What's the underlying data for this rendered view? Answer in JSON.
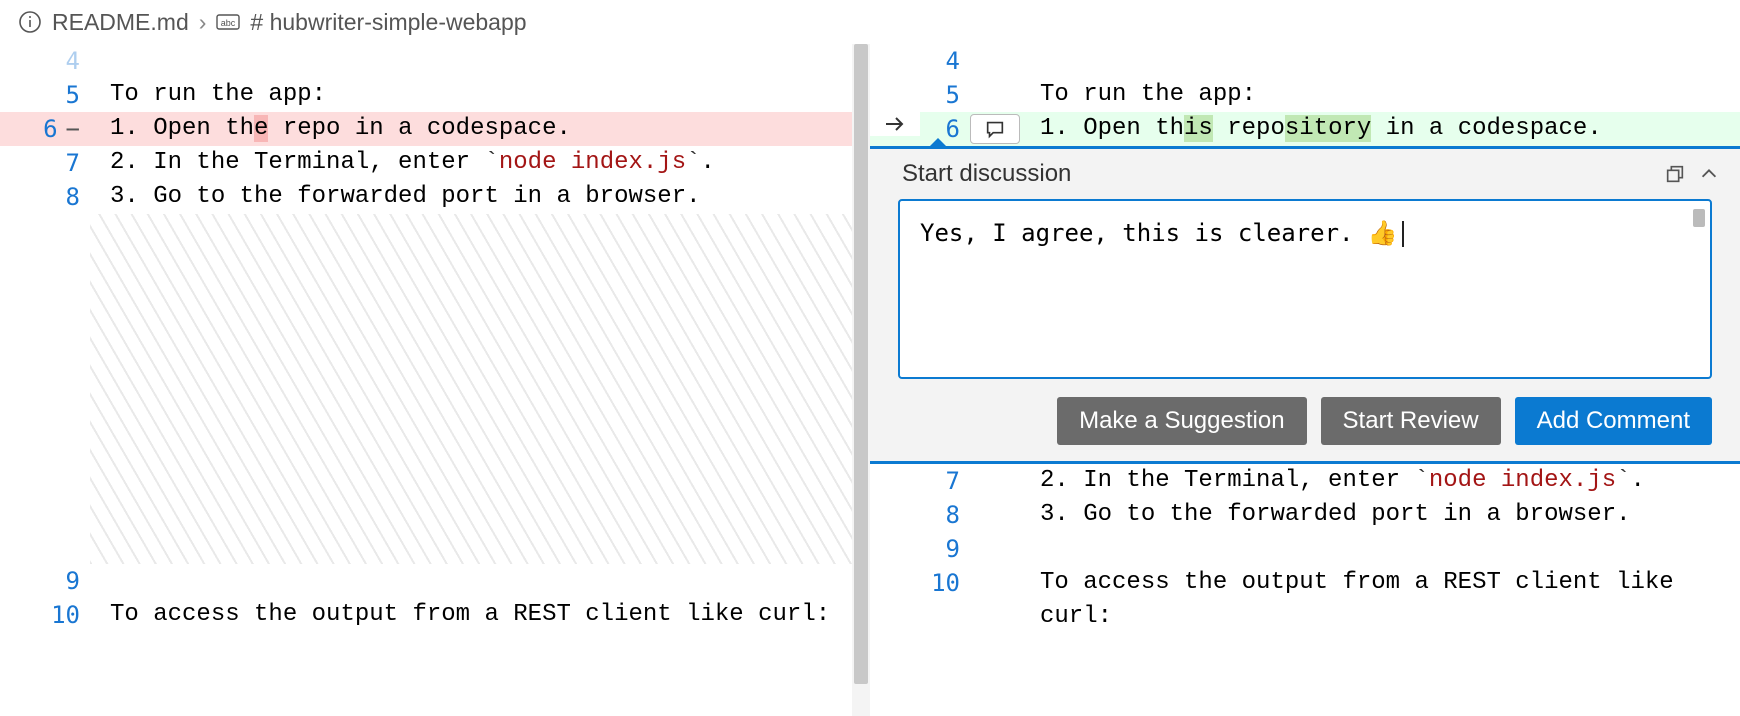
{
  "breadcrumb": {
    "file": "README.md",
    "heading": "# hubwriter-simple-webapp"
  },
  "left": {
    "lines": [
      {
        "num": "4",
        "text": ""
      },
      {
        "num": "5",
        "text": "To run the app:"
      },
      {
        "num": "6",
        "marker": "−",
        "deleted": true,
        "prefix": "1. Open th",
        "hl": "e",
        "mid": " repo",
        "suffix": " in a codespace."
      },
      {
        "num": "7",
        "text_pre": "2. In the Terminal, enter ",
        "code": "node index.js",
        "text_post": "."
      },
      {
        "num": "8",
        "text": "3. Go to the forwarded port in a browser."
      },
      {
        "num": "9",
        "text": ""
      },
      {
        "num": "10",
        "text": "To access the output from a REST client like curl:"
      }
    ]
  },
  "right": {
    "lines_top": [
      {
        "num": "4",
        "text": ""
      },
      {
        "num": "5",
        "text": "To run the app:"
      },
      {
        "num": "6",
        "arrow": true,
        "added": true,
        "prefix": "1. Open th",
        "hl1": "is",
        " ": " ",
        "mid1": " repo",
        "hl2": "sitory",
        "suffix": " in a codespace."
      }
    ],
    "lines_bottom": [
      {
        "num": "7",
        "text_pre": "2. In the Terminal, enter ",
        "code": "node index.js",
        "text_post": "."
      },
      {
        "num": "8",
        "text": "3. Go to the forwarded port in a browser."
      },
      {
        "num": "9",
        "text": ""
      },
      {
        "num": "10",
        "text": "To access the output from a REST client like curl:"
      }
    ]
  },
  "discussion": {
    "title": "Start discussion",
    "comment": "Yes, I agree, this is clearer. 👍",
    "buttons": {
      "suggestion": "Make a Suggestion",
      "review": "Start Review",
      "add": "Add Comment"
    }
  }
}
